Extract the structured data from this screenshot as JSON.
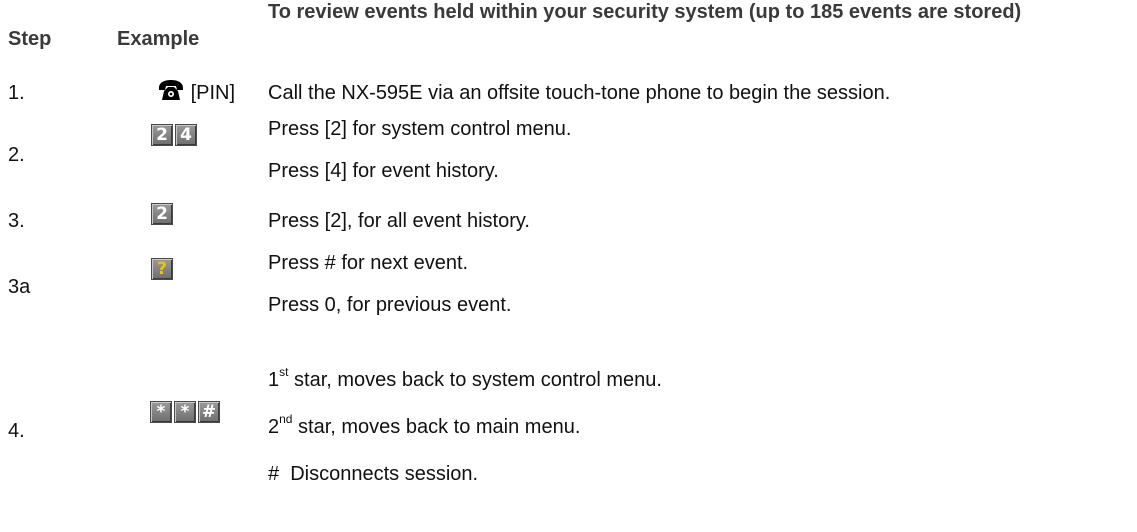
{
  "header": {
    "step": "Step",
    "example": "Example",
    "description": "To review events held within your security system (up to 185 events are stored)"
  },
  "rows": [
    {
      "step": "1.",
      "example_text": "[PIN]",
      "icon": "telephone-icon",
      "lines": [
        "Call the NX-595E via an offsite touch-tone phone to begin the session."
      ]
    },
    {
      "step": "2.",
      "keys": [
        "2",
        "4"
      ],
      "lines": [
        "Press [2] for system control menu.",
        "Press [4] for event history."
      ]
    },
    {
      "step": "3.",
      "keys": [
        "2"
      ],
      "lines": [
        "Press [2], for all event history."
      ]
    },
    {
      "step": "3a",
      "keys": [
        "?"
      ],
      "lines": [
        "Press # for next event.",
        "Press 0, for previous event."
      ]
    },
    {
      "step": "4.",
      "keys": [
        "*",
        "*",
        "#"
      ],
      "ordinals": [
        {
          "num": "1",
          "sup": "st",
          "rest": " star, moves back to system control menu."
        },
        {
          "num": "2",
          "sup": "nd",
          "rest": " star, moves back to main menu."
        }
      ],
      "last_line": "#  Disconnects session."
    }
  ]
}
